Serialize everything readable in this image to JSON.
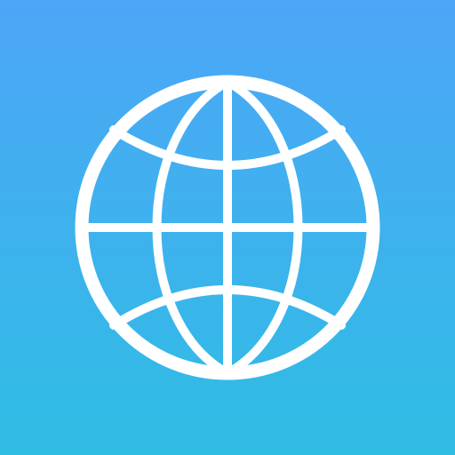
{
  "icon": {
    "name": "globe-icon",
    "background_top": "#4da6f7",
    "background_bottom": "#2fbde4",
    "glyph_color": "#ffffff"
  }
}
